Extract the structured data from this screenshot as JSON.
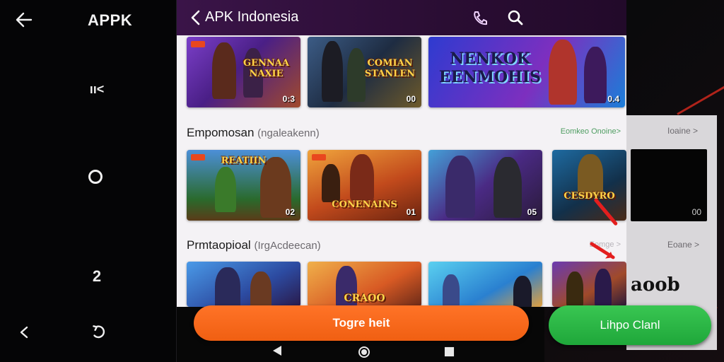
{
  "rail": {
    "title": "APPK",
    "icons": [
      "back-arrow-icon",
      "grid-dots-icon",
      "home-circle-icon",
      "number-two-icon",
      "back-chevron-icon",
      "refresh-icon"
    ],
    "glyph_a": "ıı<",
    "glyph_b": "2"
  },
  "appbar": {
    "title": "APK Indonesia",
    "icons": [
      "back-chevron-icon",
      "phone-icon",
      "search-icon"
    ],
    "color": "#3a1448"
  },
  "rows": [
    {
      "title": "",
      "cards": [
        {
          "label": "GENNAA NAXIE",
          "number": "0:3",
          "accent": "#6a2fb0"
        },
        {
          "label": "COMIAN STANLEN",
          "number": "00",
          "accent": "#2a3c5a"
        },
        {
          "label": "NENKOK EENMOHIS",
          "number": "0.4",
          "accent": "#3b2dae"
        }
      ]
    },
    {
      "title": "Empomosan",
      "subtitle": "(ngaleakenn)",
      "see_all": "Eomkeo Onoine>",
      "cards": [
        {
          "label": "REATIIN",
          "number": "02",
          "accent": "#2e6fb8"
        },
        {
          "label": "CONENAINS",
          "number": "01",
          "accent": "#d2531b"
        },
        {
          "label": "",
          "number": "05",
          "accent": "#4a2b84"
        },
        {
          "label": "CESDYRO",
          "number": "",
          "accent": "#1e4d7a"
        }
      ]
    },
    {
      "title": "Prmtaopioal",
      "subtitle": "(IrgAcdeecan)",
      "see_all": "Eomge >",
      "cards": [
        {
          "label": "",
          "number": "",
          "accent": "#3a78d8"
        },
        {
          "label": "CRAOO",
          "number": "",
          "accent": "#e0702a"
        },
        {
          "label": "",
          "number": "",
          "accent": "#2a8de0"
        },
        {
          "label": "",
          "number": "",
          "accent": "#4f2a92"
        }
      ]
    }
  ],
  "side_panel": {
    "label_top": "Ioaine >",
    "label_bottom": "Eoane >",
    "dark_number": "00",
    "scribble": "aoob"
  },
  "buttons": {
    "primary": "Togre heit",
    "secondary": "Lihpo Clanl",
    "primary_color": "#f26214",
    "secondary_color": "#2bb545"
  },
  "navbar": {
    "icons": [
      "nav-back-triangle-icon",
      "nav-home-circle-icon",
      "nav-recents-square-icon"
    ]
  }
}
